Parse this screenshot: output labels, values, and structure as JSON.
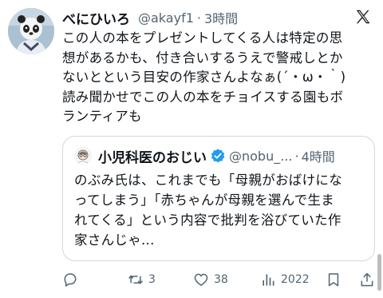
{
  "tweet": {
    "display_name": "べにひいろ",
    "handle": "@akayf1",
    "separator": "·",
    "time": "3時間",
    "text_lines": [
      "この人の本をプレゼントしてくる人は特定の思",
      "想があるかも、付き合いするうえで警戒しとか",
      "ないとという目安の作家さんよなぁ(´・ω・｀)",
      "読み聞かせでこの人の本をチョイスする園もボ",
      "ランティアも"
    ]
  },
  "quote": {
    "display_name": "小児科医のおじい",
    "handle": "@nobu_...",
    "separator": "·",
    "time": "4時間",
    "text_lines": [
      "のぶみ氏は、これまでも「母親がおばけにな",
      "ってしまう」「赤ちゃんが母親を選んで生ま",
      "れてくる」という内容で批判を浴びていた作",
      "家さんじゃ..."
    ]
  },
  "actions": {
    "retweet_count": "3",
    "like_count": "38",
    "view_count": "2022"
  },
  "icons": {
    "reply": "reply-icon",
    "retweet": "retweet-icon",
    "like": "heart-icon",
    "views": "views-icon",
    "bookmark": "bookmark-icon",
    "share": "share-icon",
    "logo": "x-logo-icon",
    "verified": "verified-badge-icon"
  },
  "colors": {
    "text": "#0f1419",
    "secondary": "#536471",
    "verified": "#1d9bf0",
    "border": "#cfd9de"
  }
}
